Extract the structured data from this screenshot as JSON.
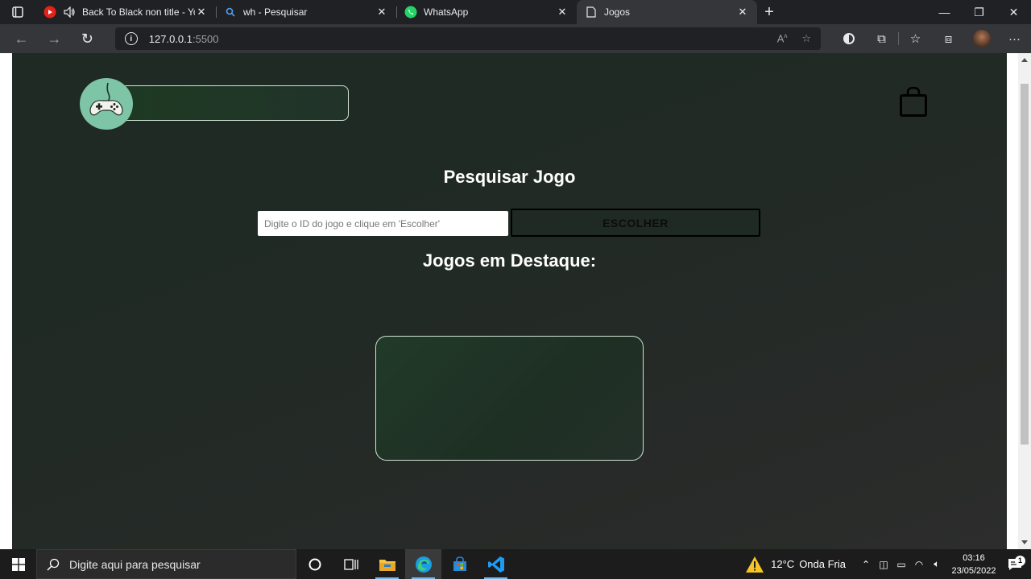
{
  "browser": {
    "tabs": [
      {
        "title": "Back To Black non title - You",
        "icon": "youtube-icon",
        "active": false
      },
      {
        "title": "wh - Pesquisar",
        "icon": "search-icon",
        "active": false
      },
      {
        "title": "WhatsApp",
        "icon": "whatsapp-icon",
        "active": false
      },
      {
        "title": "Jogos",
        "icon": "page-icon",
        "active": true
      }
    ],
    "address": {
      "host": "127.0.0.1",
      "port": ":5500"
    }
  },
  "page": {
    "search_title": "Pesquisar Jogo",
    "search_placeholder": "Digite o ID do jogo e clique em 'Escolher'",
    "choose_label": "ESCOLHER",
    "featured_title": "Jogos em Destaque:"
  },
  "taskbar": {
    "search_placeholder": "Digite aqui para pesquisar",
    "weather": {
      "temp": "12°C",
      "condition": "Onda Fria"
    },
    "clock": {
      "time": "03:16",
      "date": "23/05/2022"
    },
    "notification_count": "1"
  },
  "colors": {
    "page_bg": "#212a25",
    "logo_circle": "#7ec4a7",
    "card_border": "#cfe3d3",
    "taskbar_bg": "#1c1c1c"
  }
}
